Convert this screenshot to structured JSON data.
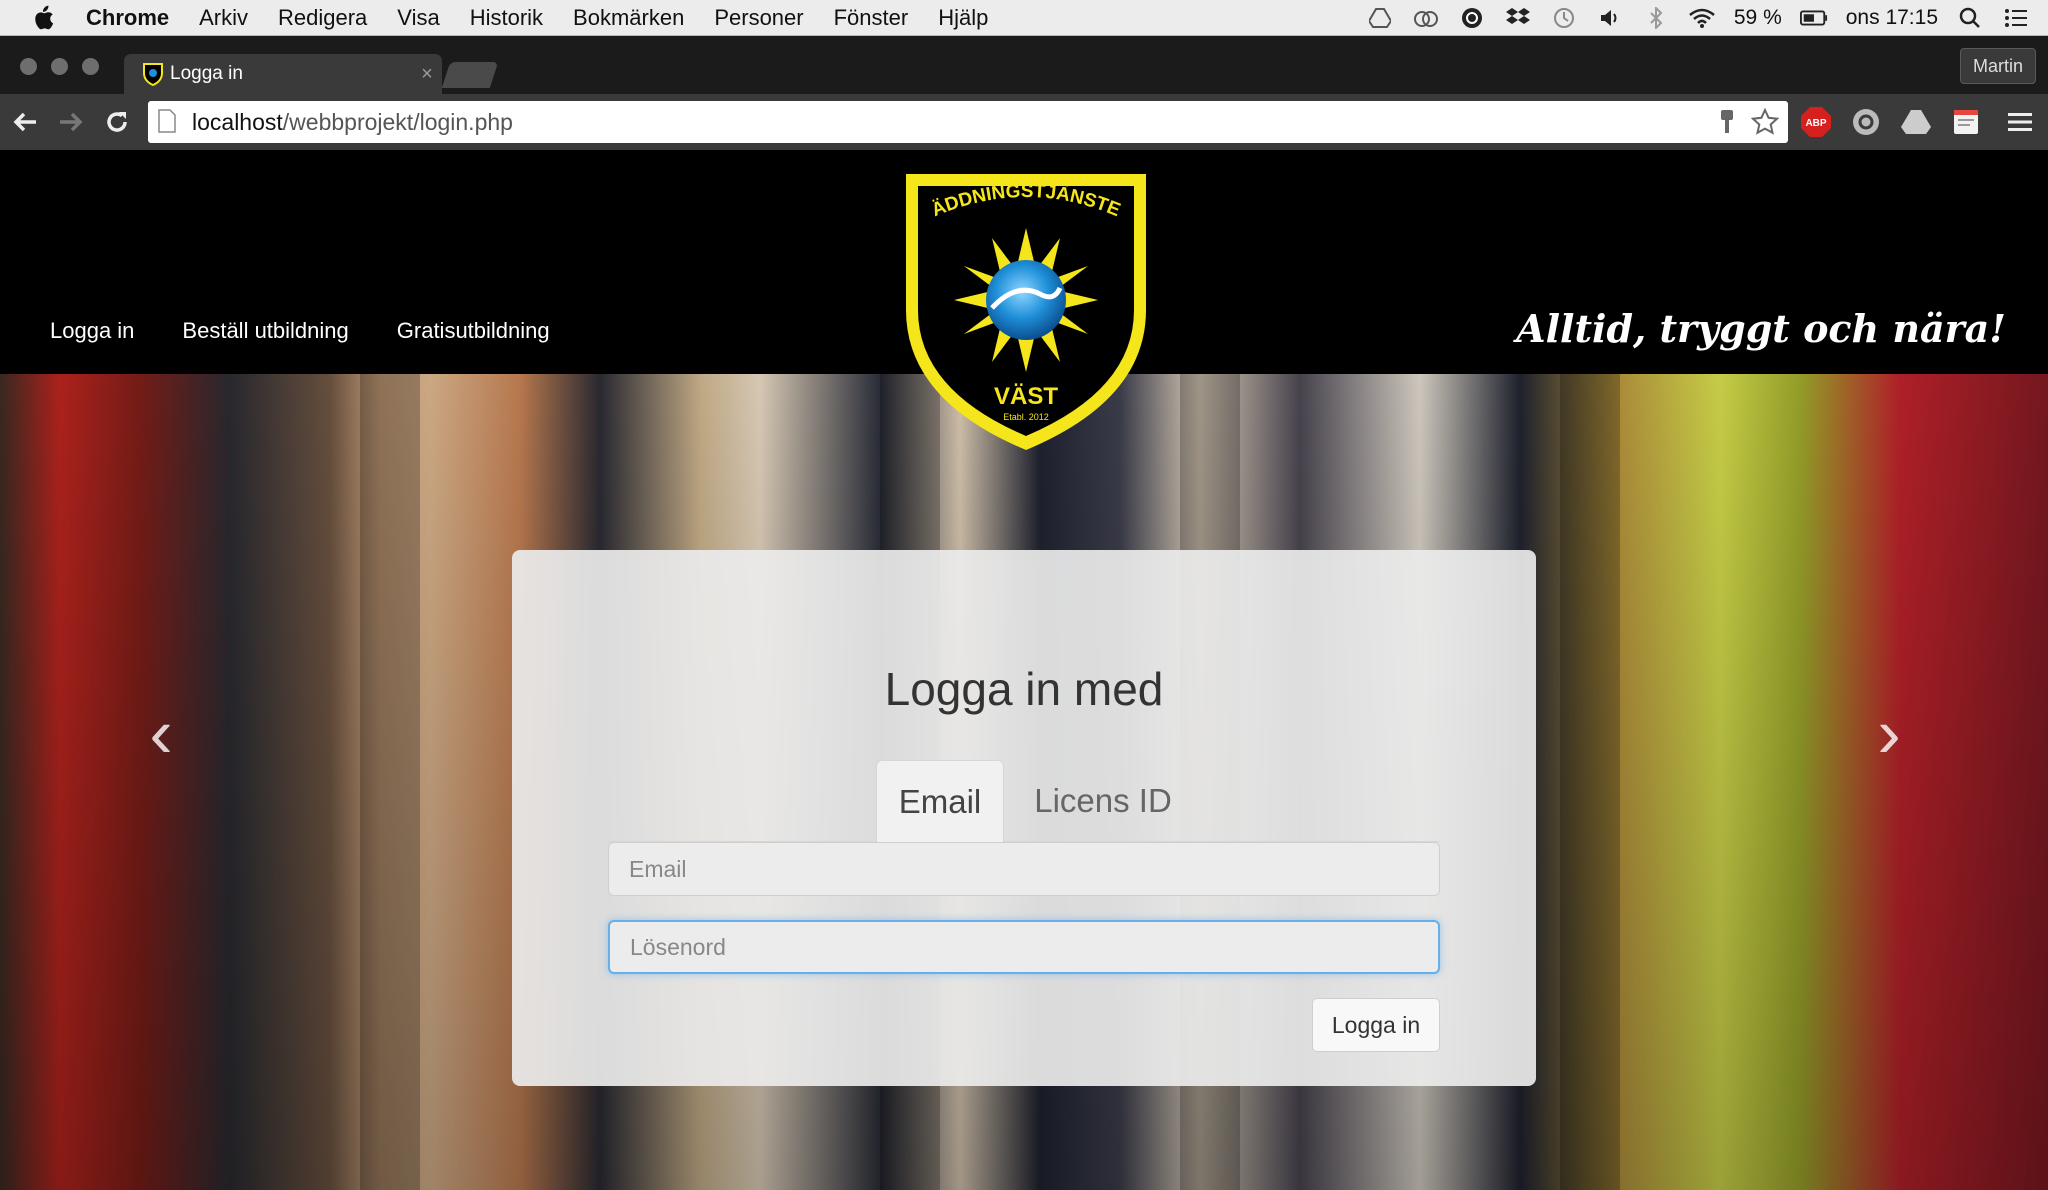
{
  "menubar": {
    "app": "Chrome",
    "items": [
      "Arkiv",
      "Redigera",
      "Visa",
      "Historik",
      "Bokmärken",
      "Personer",
      "Fönster",
      "Hjälp"
    ],
    "battery": "59 %",
    "clock": "ons 17:15"
  },
  "browser": {
    "tab_title": "Logga in",
    "tab_close": "×",
    "profile": "Martin",
    "url_host": "localhost",
    "url_path": "/webbprojekt/login.php",
    "abp_label": "ABP"
  },
  "site": {
    "nav": [
      "Logga in",
      "Beställ utbildning",
      "Gratisutbildning"
    ],
    "tagline": "Alltid, tryggt och nära!",
    "logo": {
      "top_text": "RÄDDNINGSTJÄNSTEN",
      "bottom_text": "VÄST",
      "established": "Etabl. 2012",
      "colors": {
        "border": "#f5e61c",
        "field": "#000000",
        "emblem": "#1e8fd8"
      }
    }
  },
  "login": {
    "heading": "Logga in med",
    "tabs": [
      {
        "label": "Email",
        "active": true
      },
      {
        "label": "Licens ID",
        "active": false
      }
    ],
    "email_placeholder": "Email",
    "password_placeholder": "Lösenord",
    "submit_label": "Logga in"
  },
  "carousel": {
    "prev": "‹",
    "next": "›"
  }
}
